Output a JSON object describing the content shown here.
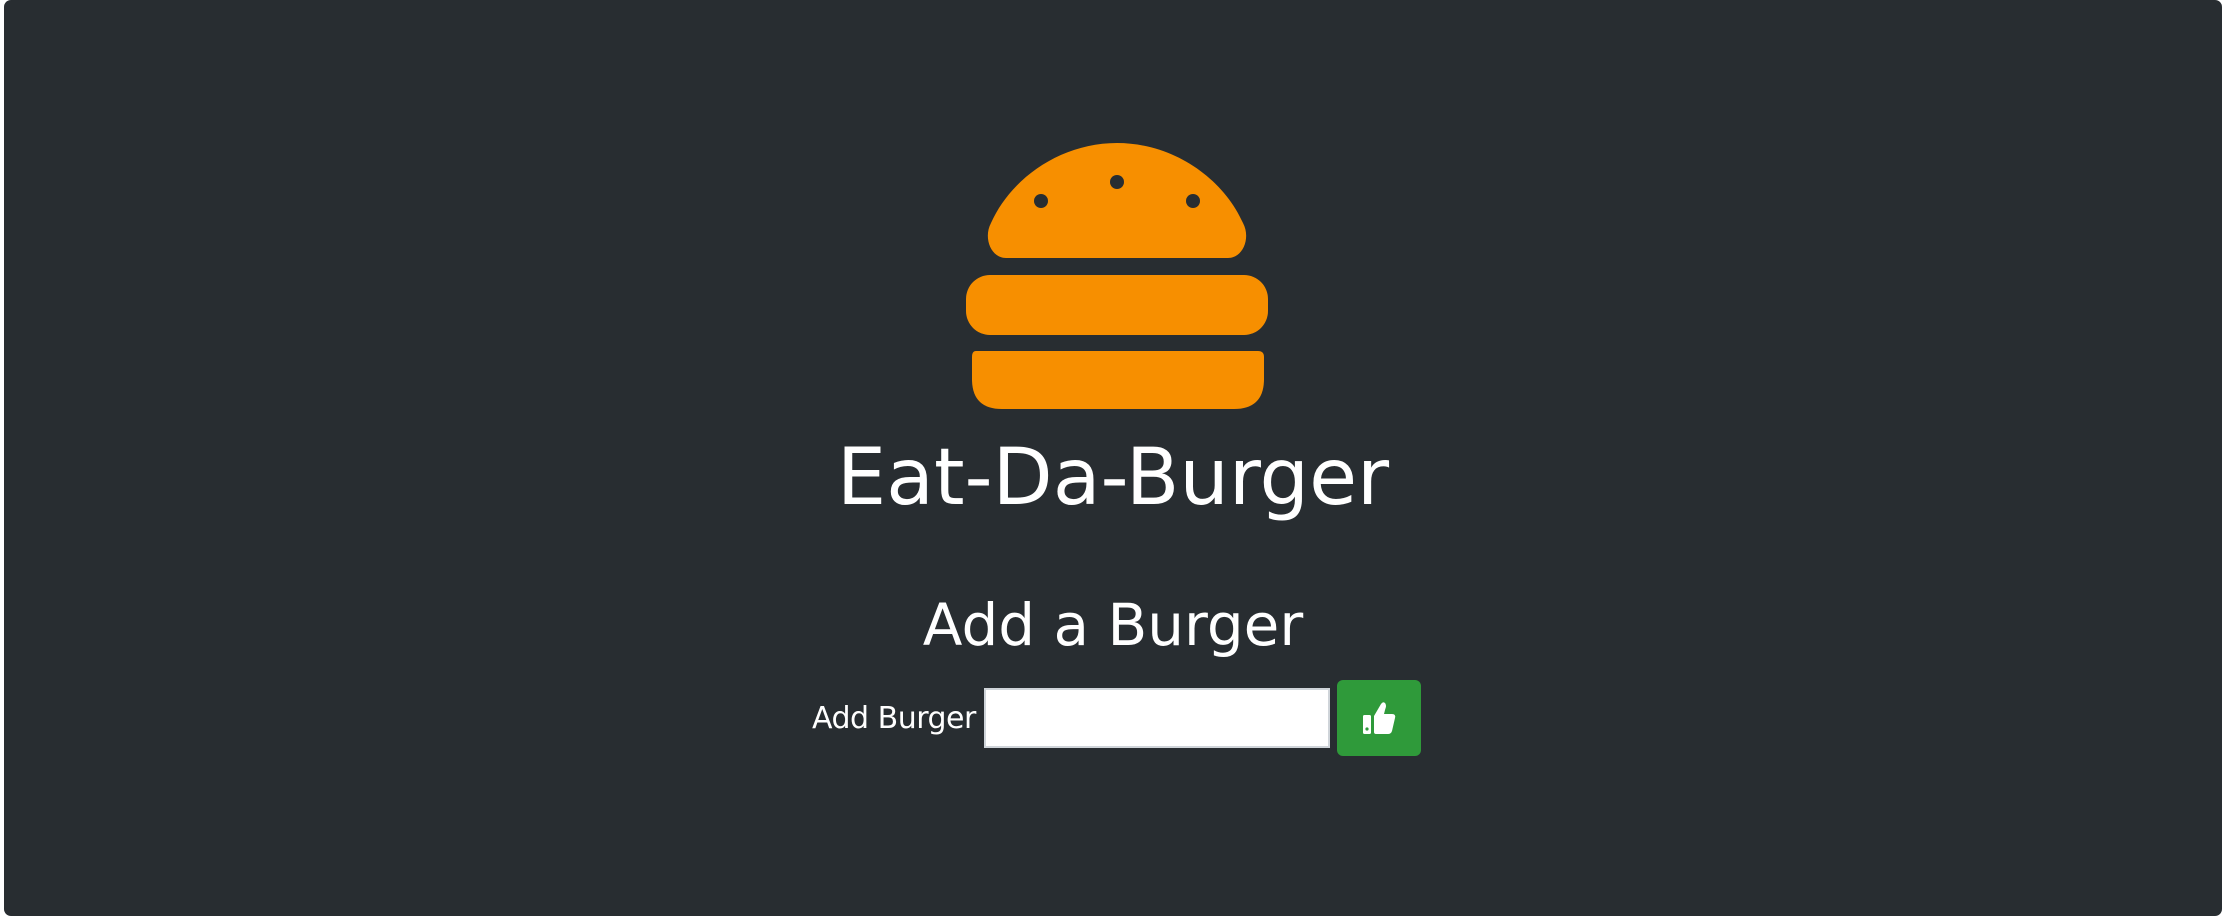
{
  "page": {
    "title": "Eat-Da-Burger"
  },
  "add_form": {
    "heading": "Add a Burger",
    "label": "Add Burger",
    "input_value": "",
    "submit_icon": "thumbs-up-icon"
  },
  "logo": {
    "icon": "burger-icon"
  },
  "colors": {
    "background": "#282d31",
    "accent": "#f78f00",
    "button": "#2f9a3a",
    "text": "#ffffff"
  }
}
